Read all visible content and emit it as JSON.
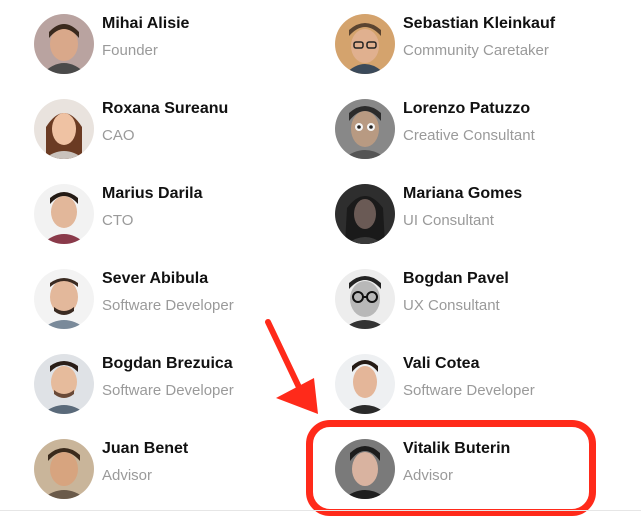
{
  "team": {
    "members": [
      {
        "name": "Mihai Alisie",
        "role": "Founder",
        "skin": "#d9a88a",
        "hair": "#3a2a1e",
        "bg": "#b9a3a0"
      },
      {
        "name": "Sebastian Kleinkauf",
        "role": "Community Caretaker",
        "skin": "#e0b08f",
        "hair": "#5a4430",
        "bg": "#d4a36d"
      },
      {
        "name": "Roxana Sureanu",
        "role": "CAO",
        "skin": "#efc2a3",
        "hair": "#6b3b23",
        "bg": "#e9e3de"
      },
      {
        "name": "Lorenzo Patuzzo",
        "role": "Creative Consultant",
        "skin": "#b89a82",
        "hair": "#2b2b2b",
        "bg": "#888888"
      },
      {
        "name": "Marius Darila",
        "role": "CTO",
        "skin": "#e2b79a",
        "hair": "#231a14",
        "bg": "#f2f2f2"
      },
      {
        "name": "Mariana Gomes",
        "role": "UI Consultant",
        "skin": "#6a5a55",
        "hair": "#1a1a1a",
        "bg": "#2e2e2e"
      },
      {
        "name": "Sever Abibula",
        "role": "Software Developer",
        "skin": "#e3b89b",
        "hair": "#3b2b22",
        "bg": "#f3f3f3"
      },
      {
        "name": "Bogdan Pavel",
        "role": "UX Consultant",
        "skin": "#b8b8b8",
        "hair": "#222222",
        "bg": "#ededed"
      },
      {
        "name": "Bogdan Brezuica",
        "role": "Software Developer",
        "skin": "#e6bb9c",
        "hair": "#2a1e18",
        "bg": "#dfe2e6"
      },
      {
        "name": "Vali Cotea",
        "role": "Software Developer",
        "skin": "#e4b699",
        "hair": "#241a14",
        "bg": "#eef0f2"
      },
      {
        "name": "Juan Benet",
        "role": "Advisor",
        "skin": "#d7a47f",
        "hair": "#3a2a1c",
        "bg": "#c9b59a"
      },
      {
        "name": "Vitalik Buterin",
        "role": "Advisor",
        "skin": "#d9b3a0",
        "hair": "#1c1c1c",
        "bg": "#7a7a7a"
      }
    ]
  },
  "annotation": {
    "arrow_color": "#ff2a1a",
    "box_color": "#ff2a1a"
  }
}
